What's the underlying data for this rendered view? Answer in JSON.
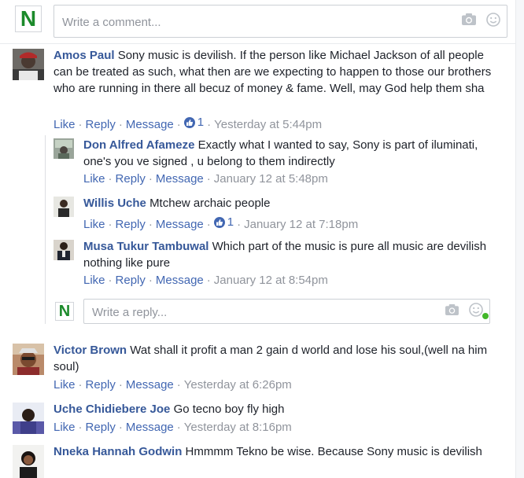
{
  "composer": {
    "placeholder": "Write a comment...",
    "logo_letter": "N"
  },
  "comments": [
    {
      "author": "Amos Paul",
      "text": "Sony music is devilish. If the person like Michael Jackson of all people can be treated as such, what then are we expecting to happen to those our brothers who are running in there all becuz of money & fame. Well, may God help them sha",
      "actions": {
        "like": "Like",
        "reply": "Reply",
        "message": "Message"
      },
      "likes": "1",
      "time": "Yesterday at 5:44pm"
    },
    {
      "author": "Don Alfred Afameze",
      "text": "Exactly what I wanted to say, Sony is part of iluminati, one's you ve signed , u belong to them indirectly",
      "actions": {
        "like": "Like",
        "reply": "Reply",
        "message": "Message"
      },
      "time": "January 12 at 5:48pm"
    },
    {
      "author": "Willis Uche",
      "text": "Mtchew archaic people",
      "actions": {
        "like": "Like",
        "reply": "Reply",
        "message": "Message"
      },
      "likes": "1",
      "time": "January 12 at 7:18pm"
    },
    {
      "author": "Musa Tukur Tambuwal",
      "text": "Which part of the music is pure all music are devilish nothing like pure",
      "actions": {
        "like": "Like",
        "reply": "Reply",
        "message": "Message"
      },
      "time": "January 12 at 8:54pm"
    },
    {
      "author": "Victor Brown",
      "text": "Wat shall it profit a man 2 gain d world and lose his soul,(well na him soul)",
      "actions": {
        "like": "Like",
        "reply": "Reply",
        "message": "Message"
      },
      "time": "Yesterday at 6:26pm"
    },
    {
      "author": "Uche Chidiebere Joe",
      "text": "Go tecno boy fly high",
      "actions": {
        "like": "Like",
        "reply": "Reply",
        "message": "Message"
      },
      "time": "Yesterday at 8:16pm"
    },
    {
      "author": "Nneka Hannah Godwin",
      "text": "Hmmmm Tekno be wise. Because Sony music is devilish"
    }
  ],
  "reply_composer": {
    "placeholder": "Write a reply...",
    "logo_letter": "N"
  },
  "icons": {
    "camera": "camera-icon",
    "emoji": "emoji-icon",
    "like": "thumbs-up-icon"
  },
  "colors": {
    "link": "#4267b2",
    "author": "#365899",
    "meta": "#90949c",
    "logo_green": "#1b8a2a",
    "online": "#42b72a"
  }
}
